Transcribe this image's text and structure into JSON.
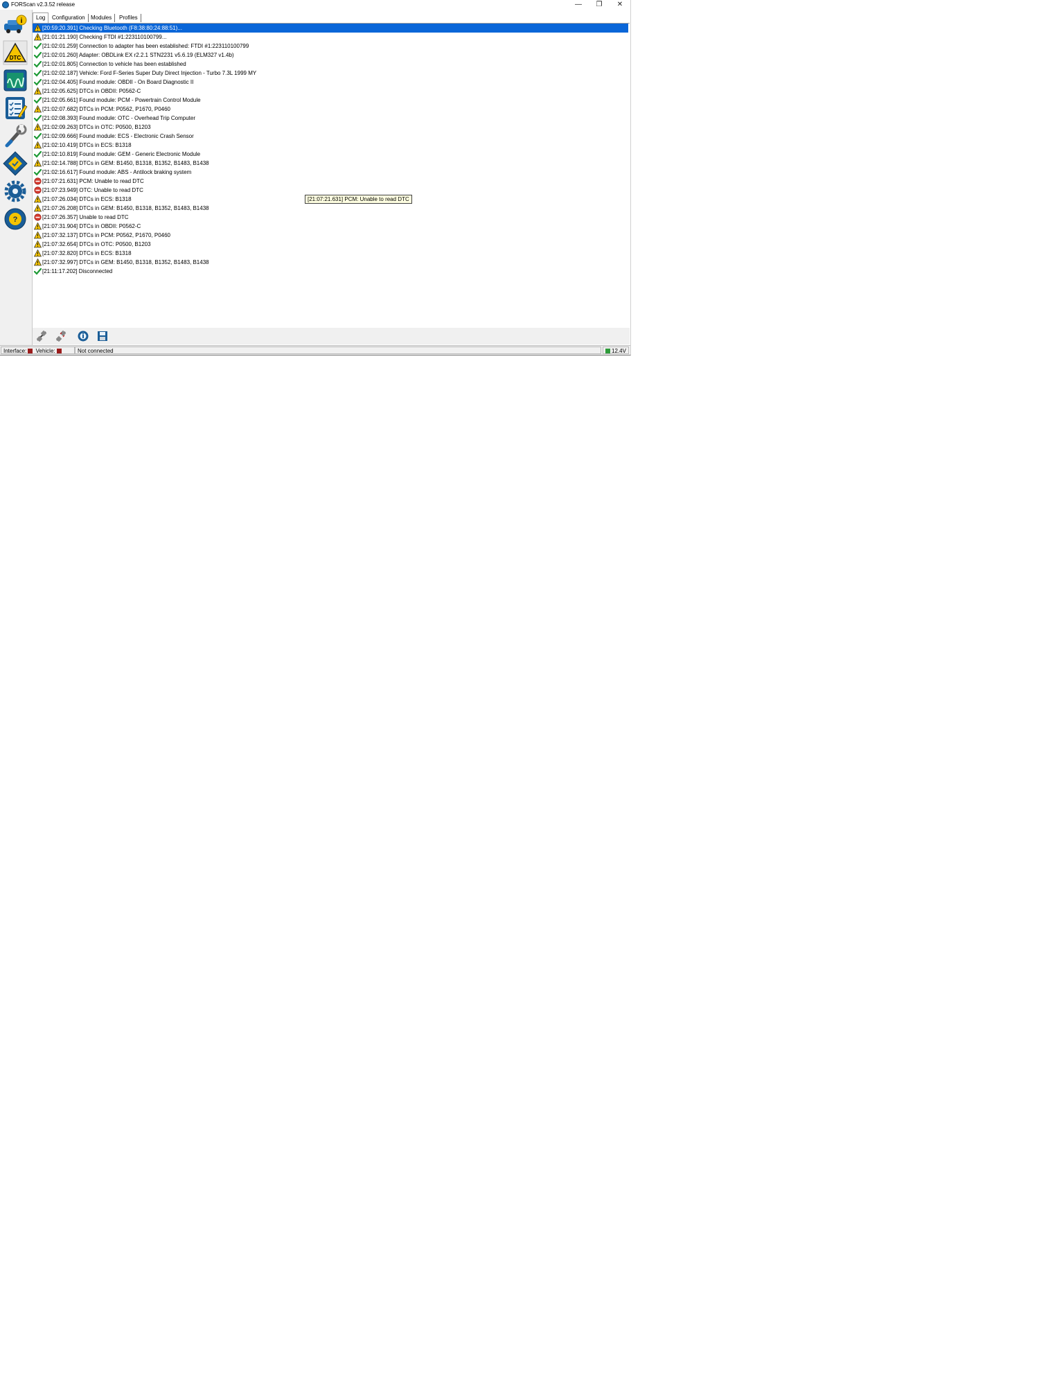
{
  "window": {
    "title": "FORScan v2.3.52 release",
    "minimize": "—",
    "restore": "❐",
    "close": "✕"
  },
  "tabs": [
    "Log",
    "Configuration",
    "Modules",
    "Profiles"
  ],
  "sidebar": [
    {
      "icon": "vehicle-info-icon"
    },
    {
      "icon": "dtc-icon",
      "label": "DTC"
    },
    {
      "icon": "oscilloscope-icon"
    },
    {
      "icon": "tests-checklist-icon"
    },
    {
      "icon": "service-wrench-icon"
    },
    {
      "icon": "programming-chip-icon"
    },
    {
      "icon": "settings-gear-icon"
    },
    {
      "icon": "help-icon"
    }
  ],
  "log": [
    {
      "type": "warning",
      "text": "[20:59:20.391] Checking Bluetooth (F8:38:80:24:88:51)...",
      "selected": true
    },
    {
      "type": "warning",
      "text": "[21:01:21.190] Checking FTDI #1:223110100799..."
    },
    {
      "type": "ok",
      "text": "[21:02:01.259] Connection to adapter has been established: FTDI #1:223110100799"
    },
    {
      "type": "ok",
      "text": "[21:02:01.260] Adapter:  OBDLink EX r2.2.1 STN2231 v5.6.19 (ELM327 v1.4b)"
    },
    {
      "type": "ok",
      "text": "[21:02:01.805] Connection to vehicle has been established"
    },
    {
      "type": "ok",
      "text": "[21:02:02.187] Vehicle: Ford F-Series Super Duty Direct Injection - Turbo 7.3L 1999 MY"
    },
    {
      "type": "ok",
      "text": "[21:02:04.405] Found module:  OBDII - On Board Diagnostic II"
    },
    {
      "type": "warning",
      "text": "[21:02:05.625] DTCs in OBDII: P0562-C"
    },
    {
      "type": "ok",
      "text": "[21:02:05.661] Found module:  PCM - Powertrain Control Module"
    },
    {
      "type": "warning",
      "text": "[21:02:07.682] DTCs in PCM: P0562, P1670, P0460"
    },
    {
      "type": "ok",
      "text": "[21:02:08.393] Found module:  OTC - Overhead Trip Computer"
    },
    {
      "type": "warning",
      "text": "[21:02:09.263] DTCs in OTC: P0500, B1203"
    },
    {
      "type": "ok",
      "text": "[21:02:09.666] Found module:  ECS - Electronic Crash Sensor"
    },
    {
      "type": "warning",
      "text": "[21:02:10.419] DTCs in ECS: B1318"
    },
    {
      "type": "ok",
      "text": "[21:02:10.819] Found module:  GEM - Generic Electronic Module"
    },
    {
      "type": "warning",
      "text": "[21:02:14.788] DTCs in GEM: B1450, B1318, B1352, B1483, B1438"
    },
    {
      "type": "ok",
      "text": "[21:02:16.617] Found module:  ABS - Antilock braking system"
    },
    {
      "type": "error",
      "text": "[21:07:21.631] PCM: Unable to read DTC"
    },
    {
      "type": "error",
      "text": "[21:07:23.949] OTC: Unable to read DTC"
    },
    {
      "type": "warning",
      "text": "[21:07:26.034] DTCs in ECS: B1318"
    },
    {
      "type": "warning",
      "text": "[21:07:26.208] DTCs in GEM: B1450, B1318, B1352, B1483, B1438"
    },
    {
      "type": "error",
      "text": "[21:07:26.357] Unable to read DTC"
    },
    {
      "type": "warning",
      "text": "[21:07:31.904] DTCs in OBDII: P0562-C"
    },
    {
      "type": "warning",
      "text": "[21:07:32.137] DTCs in PCM: P0562, P1670, P0460"
    },
    {
      "type": "warning",
      "text": "[21:07:32.654] DTCs in OTC: P0500, B1203"
    },
    {
      "type": "warning",
      "text": "[21:07:32.820] DTCs in ECS: B1318"
    },
    {
      "type": "warning",
      "text": "[21:07:32.997] DTCs in GEM: B1450, B1318, B1352, B1483, B1438"
    },
    {
      "type": "ok",
      "text": "[21:11:17.202] Disconnected"
    }
  ],
  "tooltip": "[21:07:21.631] PCM: Unable to read DTC",
  "toolbar": [
    "connect-icon",
    "disconnect-icon",
    "info-icon",
    "save-icon"
  ],
  "status": {
    "interface_label": "Interface:",
    "vehicle_label": "Vehicle:",
    "connection": "Not connected",
    "voltage": "12.4V",
    "interface_color": "#9b1c1c",
    "vehicle_color": "#9b1c1c",
    "voltage_color": "#2e9b3a"
  }
}
